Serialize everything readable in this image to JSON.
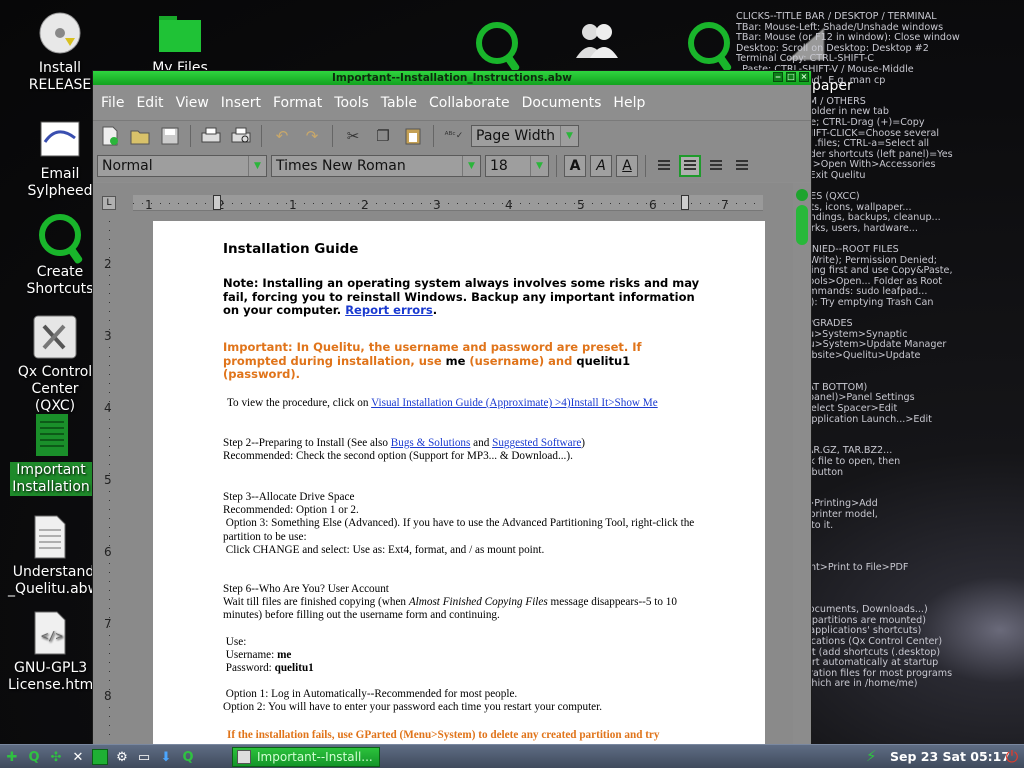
{
  "desktop": {
    "icons": [
      {
        "label": "Install RELEASE"
      },
      {
        "label": "My Files"
      },
      {
        "label": "Email Sylpheed"
      },
      {
        "label": "Create Shortcuts"
      },
      {
        "label": "Qx Control Center (QXC)"
      },
      {
        "label": "Important Installation"
      },
      {
        "label": "Understand _Quelitu.abw"
      },
      {
        "label": "GNU-GPL3 License.htm"
      },
      {
        "label": "paper"
      }
    ],
    "info_text": "CLICKS--TITLE BAR / DESKTOP / TERMINAL\nTBar: Mouse-Left: Shade/Unshade windows\nTBar: Mouse (or F12 in window): Close window\nDesktop: Scroll on Desktop: Desktop #2\nTerminal Copy: CTRL-SHIFT-C\n  Paste: CTRL-SHIFT-V / Mouse-Middle\n  Help: Command'. E.g. man cp\n\nFILES--PCMANFM / OTHERS\nMiddle: Opens folder in new tab\nDrag (<-)=move; CTRL-Drag (+)=Copy\nCTRL-CLICK>SHIFT-CLICK=Choose several\nCTRL-H: Hidden .files; CTRL-a=Select all\nDrag files to folder shortcuts (left panel)=Yes\nRight-Click (file)>Open With>Accessories\nCTRL-ALT-DEL=Exit Quelitu\n\nCENTER UTILITIES (QXCC)\nWallpapers, fonts, icons, wallpaper...\nKeyboard keybindings, backups, cleanup...\nSettings, networks, users, hardware...\n\nPERMISSION DENIED--ROOT FILES\nTo Open File to Write); Permission Denied;\nSome: Try deleting first and use Copy&Paste,\nOr Top Menu>Tools>Open... Folder as Root\nSudo before commands: sudo leafpad...\nCopying to USB): Try emptying Trash Can\n\nPROGRAMS / UPGRADES\nPrograms: Menu>System>Synaptic\nUpgrades: Menu>System>Update Manager\nFaq: Quelitu Website>Quelitu>Update\n\n\nTOP TOOLBAR AT BOTTOM)\nRight-click (on panel)>Panel Settings\nAdd/Remove>Select Spacer>Edit\nAdd/Remove>Application Launch...>Edit\n\n\nZIP, 7Z, RAR, TAR.GZ, TAR.BZ2...\nAs archive: Click file to open, then\nEXTRACT FILES button\n\n\nMenu>System>Printing>Add\nDriver for your printer model,\nChoose closest to it.\n\n\nFILES\nMenus: File>Print>Print to File>PDF\n\n\nLOCATIONS\nHome folder: Documents, Downloads...)\nCDs, USB keys, partitions are mounted)\nIcons, themes, applications' shortcuts)\n/usr/share/applications (Qx Control Center)\n.config/autostart (add shortcuts (.desktop)\nPrograms to start automatically at startup\nConfig (configuration files for most programs\nand browsers which are in /home/me)"
  },
  "window": {
    "title": "Important--Installation_Instructions.abw",
    "menu": [
      "File",
      "Edit",
      "View",
      "Insert",
      "Format",
      "Tools",
      "Table",
      "Collaborate",
      "Documents",
      "Help"
    ],
    "zoom": "Page Width",
    "style": "Normal",
    "font": "Times New Roman",
    "size": "18",
    "ruler_h": [
      "1",
      "2",
      "1",
      "2",
      "3",
      "4",
      "5",
      "6",
      "7"
    ],
    "ruler_v": [
      "2",
      "3",
      "4",
      "5",
      "6",
      "7",
      "8"
    ]
  },
  "doc": {
    "title": "Installation Guide",
    "note": "Note: Installing an operating system always involves some risks and may fail, forcing you to reinstall Windows. Backup any important information on your computer.",
    "note_link": "Report errors",
    "important_a": "Important: In Quelitu, the username and password are preset. If prompted during installation, use ",
    "important_me": "me",
    "important_b": " (username) and ",
    "important_pw": "quelitu1",
    "important_c": " (password).",
    "view_text": "To view the procedure, click on ",
    "view_link": "Visual Installation Guide (Approximate) >4)Install It>Show Me",
    "step2_a": "Step 2--Preparing to Install (See also ",
    "step2_link1": "Bugs & Solutions",
    "step2_and": " and ",
    "step2_link2": "Suggested Software",
    "step2_b": ")",
    "step2_rec": "Recommended: Check the second option (Support for MP3... & Download...).",
    "step3_title": "Step 3--Allocate Drive Space",
    "step3_rec": "Recommended: Option 1 or 2.",
    "step3_opt3": " Option 3: Something Else (Advanced). If you have to use the Advanced Partitioning Tool, right-click the partition to be use:",
    "step3_change": " Click CHANGE and select: Use as: Ext4, format, and / as mount point.",
    "step6_title": "Step 6--Who Are You? User Account",
    "step6_wait_a": "Wait till files are finished copying (when ",
    "step6_wait_i": "Almost Finished Copying Files",
    "step6_wait_b": " message disappears--5 to 10 minutes) before filling out the username form and continuing.",
    "use_label": " Use:",
    "username_label": " Username: ",
    "username_val": "me",
    "password_label": " Password: ",
    "password_val": "quelitu1",
    "opt1": " Option 1: Log in Automatically--Recommended for most people.",
    "opt2": "Option 2: You will have to enter your password each time you restart your computer.",
    "fail": "If the installation fails, use GParted (Menu>System) to delete any created partition and try"
  },
  "taskbar": {
    "task_label": "Important--Install...",
    "clock": "Sep 23 Sat 05:17"
  },
  "colors": {
    "accent": "#19b52b",
    "orange": "#e0741a",
    "link": "#1a3ad0"
  }
}
